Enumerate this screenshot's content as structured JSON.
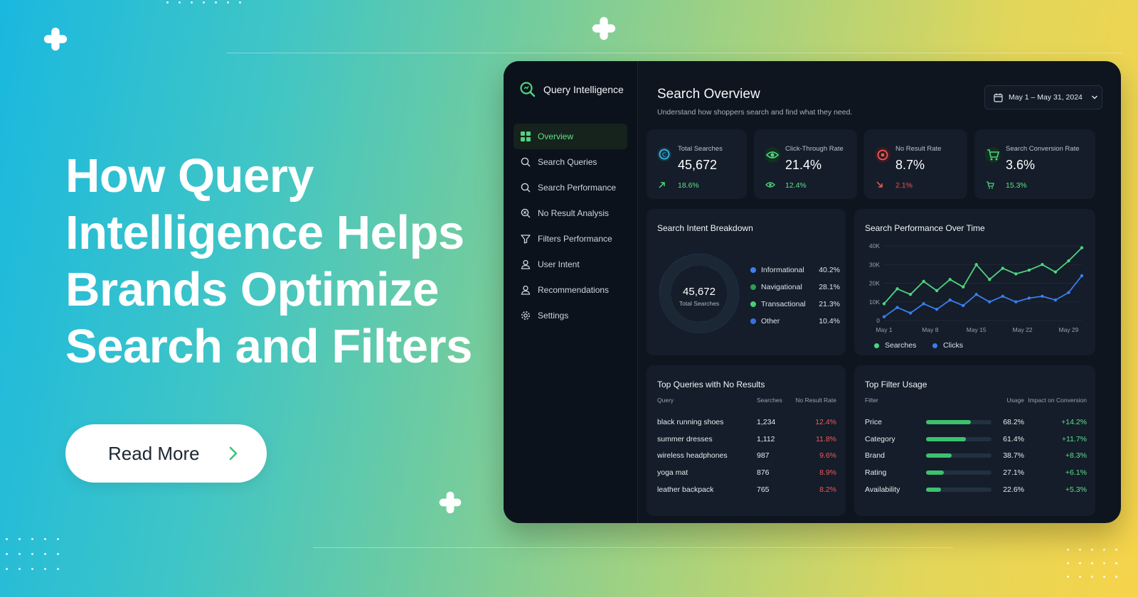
{
  "hero": {
    "headline_lines": [
      "How Query",
      "Intelligence Helps",
      "Brands Optimize",
      "Search and Filters"
    ],
    "button_label": "Read More"
  },
  "app": {
    "name": "Query Intelligence"
  },
  "sidebar": {
    "items": [
      {
        "label": "Overview",
        "icon": "grid-icon",
        "active": true
      },
      {
        "label": "Search Queries",
        "icon": "search-icon"
      },
      {
        "label": "Search Performance",
        "icon": "search-icon"
      },
      {
        "label": "No Result Analysis",
        "icon": "search-x-icon"
      },
      {
        "label": "Filters Performance",
        "icon": "filter-icon"
      },
      {
        "label": "User Intent",
        "icon": "user-icon"
      },
      {
        "label": "Recommendations",
        "icon": "user-icon"
      },
      {
        "label": "Settings",
        "icon": "gear-icon"
      }
    ]
  },
  "header": {
    "title": "Search Overview",
    "subtitle": "Understand how shoppers search and find what they need.",
    "date_range": "May 1 – May 31, 2024"
  },
  "kpis": [
    {
      "label": "Total Searches",
      "value": "45,672",
      "change": "18.6%",
      "color": "#3ab9e8"
    },
    {
      "label": "Click-Through Rate",
      "value": "21.4%",
      "change": "12.4%",
      "color": "#4fd47f"
    },
    {
      "label": "No Result Rate",
      "value": "8.7%",
      "change": "2.1%",
      "color": "#ef5a5a"
    },
    {
      "label": "Search Conversion Rate",
      "value": "3.6%",
      "change": "15.3%",
      "color": "#4fd47f"
    }
  ],
  "intent": {
    "title": "Search Intent Breakdown",
    "center_value": "45,672",
    "center_label": "Total Searches",
    "chart_data": {
      "type": "pie",
      "labels": [
        "Informational",
        "Navigational",
        "Transactional",
        "Other"
      ],
      "values": [
        40.2,
        28.1,
        21.3,
        10.4
      ],
      "display": [
        "40.2%",
        "28.1%",
        "21.3%",
        "10.4%"
      ],
      "colors": [
        "#3f7ff0",
        "#2e9d55",
        "#47cf77",
        "#3a6fe0"
      ]
    }
  },
  "performance": {
    "title": "Search Performance Over Time",
    "y_ticks": [
      "40K",
      "30K",
      "20K",
      "10K",
      "0"
    ],
    "x_ticks": [
      "May 1",
      "May 8",
      "May 15",
      "May 22",
      "May 29"
    ],
    "chart_data": {
      "type": "line",
      "x": [
        1,
        3,
        5,
        7,
        9,
        11,
        13,
        15,
        17,
        19,
        21,
        23,
        25,
        27,
        29,
        31
      ],
      "ylim": [
        0,
        40000
      ],
      "series": [
        {
          "name": "Searches",
          "color": "#4fd47f",
          "values": [
            9000,
            17000,
            14000,
            21000,
            16000,
            22000,
            18000,
            30000,
            22000,
            28000,
            25000,
            27000,
            30000,
            26000,
            32000,
            39000
          ]
        },
        {
          "name": "Clicks",
          "color": "#3b7df0",
          "values": [
            2000,
            7000,
            4000,
            9000,
            6000,
            11000,
            8000,
            14000,
            10000,
            13000,
            10000,
            12000,
            13000,
            11000,
            15000,
            24000
          ]
        }
      ]
    }
  },
  "no_results": {
    "title": "Top Queries with No Results",
    "columns": [
      "Query",
      "Searches",
      "No Result Rate"
    ],
    "rows": [
      [
        "black running shoes",
        "1,234",
        "12.4%"
      ],
      [
        "summer dresses",
        "1,112",
        "11.8%"
      ],
      [
        "wireless headphones",
        "987",
        "9.6%"
      ],
      [
        "yoga mat",
        "876",
        "8.9%"
      ],
      [
        "leather backpack",
        "765",
        "8.2%"
      ]
    ]
  },
  "filters": {
    "title": "Top Filter Usage",
    "columns": [
      "Filter",
      "Usage",
      "Impact on Conversion"
    ],
    "rows": [
      {
        "name": "Price",
        "usage": "68.2%",
        "usage_value": 68.2,
        "impact": "+14.2%"
      },
      {
        "name": "Category",
        "usage": "61.4%",
        "usage_value": 61.4,
        "impact": "+11.7%"
      },
      {
        "name": "Brand",
        "usage": "38.7%",
        "usage_value": 38.7,
        "impact": "+8.3%"
      },
      {
        "name": "Rating",
        "usage": "27.1%",
        "usage_value": 27.1,
        "impact": "+6.1%"
      },
      {
        "name": "Availability",
        "usage": "22.6%",
        "usage_value": 22.6,
        "impact": "+5.3%"
      }
    ]
  }
}
